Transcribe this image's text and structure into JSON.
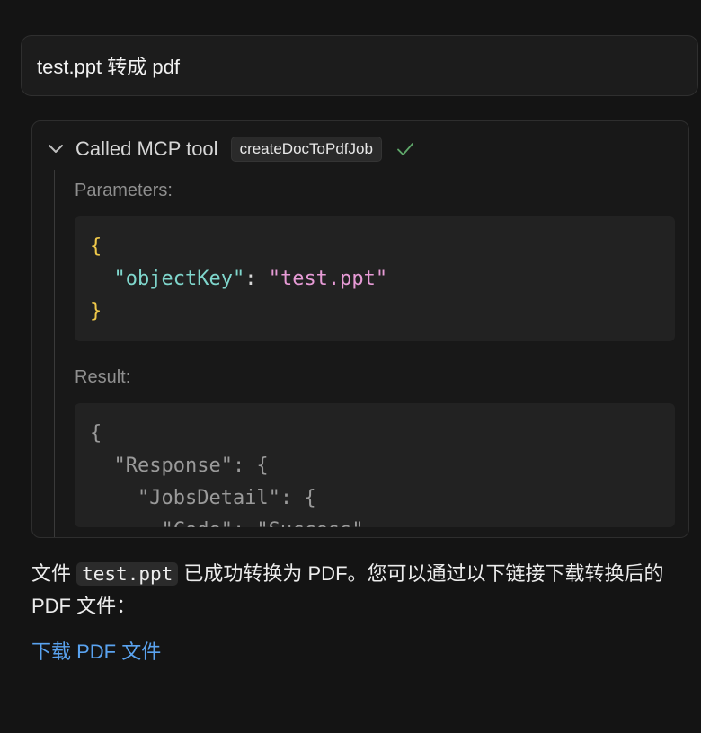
{
  "user_message": {
    "text": "test.ppt 转成 pdf"
  },
  "tool_call": {
    "title": "Called MCP tool",
    "tool_name": "createDocToPdfJob",
    "parameters_label": "Parameters:",
    "result_label": "Result:",
    "parameters_code": {
      "open_brace": "{",
      "key": "\"objectKey\"",
      "colon": ": ",
      "value": "\"test.ppt\"",
      "close_brace": "}"
    },
    "result_code": {
      "lines": [
        "{",
        "  \"Response\": {",
        "    \"JobsDetail\": {",
        "      \"Code\": \"Success\","
      ]
    }
  },
  "assistant_reply": {
    "prefix": "文件 ",
    "code": "test.ppt",
    "suffix": " 已成功转换为 PDF。您可以通过以下链接下载转换后的 PDF 文件：",
    "link_text": "下载 PDF 文件"
  },
  "colors": {
    "background": "#141414",
    "link": "#5aa3f0",
    "check": "#5fa86a"
  },
  "icons": {
    "expand": "chevron-down-icon",
    "status": "check-icon"
  }
}
